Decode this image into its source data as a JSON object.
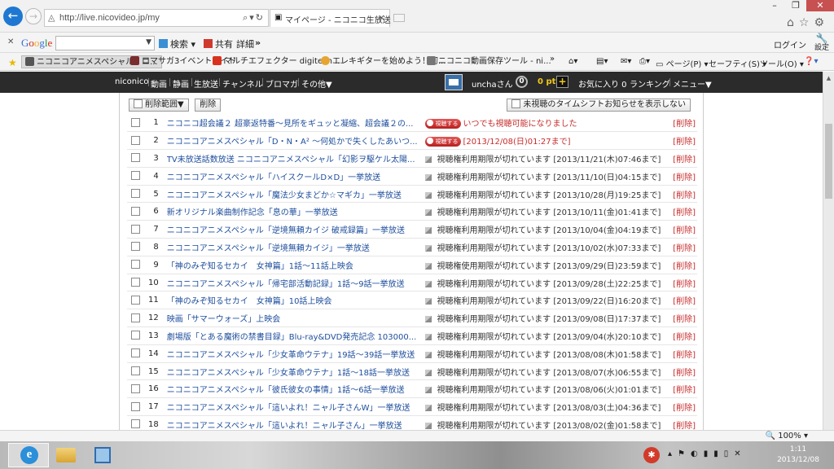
{
  "browser": {
    "url": "http://live.nicovideo.jp/my",
    "tab_title": "マイページ - ニコニコ生放送"
  },
  "google_toolbar": {
    "logo": "Google",
    "search_label": "検索",
    "share_label": "共有",
    "details_label": "詳細",
    "more": "»",
    "login": "ログイン",
    "settings": "設定"
  },
  "favorites": [
    "ニコニコアニメスペシャル - ニ...",
    "ロマサガ3イベントガイド",
    "マルチエフェクター digitech ...",
    "エレキギターを始めよう！初...",
    "ニコニコ動画保存ツール - ni..."
  ],
  "favorites_more": "»",
  "commands": {
    "page": "ページ(P)",
    "safety": "セーフティ(S)",
    "tools": "ツール(O)"
  },
  "nico_header": {
    "links": [
      "niconico",
      "動画",
      "静画",
      "生放送",
      "チャンネル",
      "ブロマガ",
      "その他▼"
    ],
    "username": "unchaさん",
    "points_badge": "0",
    "points": "0 pt",
    "plus": "+",
    "favorites": "お気に入り 0",
    "ranking": "ランキング",
    "menu": "メニュー▼"
  },
  "controls": {
    "delete_range": "削除範囲▼",
    "delete": "削除",
    "hide_unwatched": "未視聴のタイムシフトお知らせを表示しない",
    "watch_badge": "視聴する"
  },
  "rows": [
    {
      "num": "1",
      "title": "ニコニコ超会議２ 超豪返特番〜見所をギュッと凝縮、超会議２の...",
      "status": "いつでも視聴可能になりました",
      "kind": "watch",
      "delete": "[削除]"
    },
    {
      "num": "2",
      "title": "ニコニコアニメスペシャル「D・N・A² 〜何処かで失くしたあいつ...",
      "status": "[2013/12/08(日)01:27まで]",
      "kind": "watch",
      "delete": "[削除]"
    },
    {
      "num": "3",
      "title": "TV未放送話数放送 ニコニコアニメスペシャル「幻影ヲ駆ケル太陽...",
      "status": "視聴権利用期限が切れています [2013/11/21(木)07:46まで]",
      "kind": "expired",
      "delete": "[削除]"
    },
    {
      "num": "4",
      "title": "ニコニコアニメスペシャル「ハイスクールD×D」一挙放送",
      "status": "視聴権利用期限が切れています [2013/11/10(日)04:15まで]",
      "kind": "expired",
      "delete": "[削除]"
    },
    {
      "num": "5",
      "title": "ニコニコアニメスペシャル「魔法少女まどか☆マギカ」一挙放送",
      "status": "視聴権利用期限が切れています [2013/10/28(月)19:25まで]",
      "kind": "expired",
      "delete": "[削除]"
    },
    {
      "num": "6",
      "title": "新オリジナル楽曲制作記念「息の華」一挙放送",
      "status": "視聴権利用期限が切れています [2013/10/11(金)01:41まで]",
      "kind": "expired",
      "delete": "[削除]"
    },
    {
      "num": "7",
      "title": "ニコニコアニメスペシャル「逆境無頼カイジ 破戒録篇」一挙放送",
      "status": "視聴権利用期限が切れています [2013/10/04(金)04:19まで]",
      "kind": "expired",
      "delete": "[削除]"
    },
    {
      "num": "8",
      "title": "ニコニコアニメスペシャル「逆境無頼カイジ」一挙放送",
      "status": "視聴権利用期限が切れています [2013/10/02(水)07:33まで]",
      "kind": "expired",
      "delete": "[削除]"
    },
    {
      "num": "9",
      "title": "「神のみぞ知るセカイ　女神篇」1話〜11話上映会",
      "status": "視聴権使用期限が切れています [2013/09/29(日)23:59まで]",
      "kind": "expired",
      "delete": "[削除]"
    },
    {
      "num": "10",
      "title": "ニコニコアニメスペシャル「帰宅部活動記録」1話〜9話一挙放送",
      "status": "視聴権利用期限が切れています [2013/09/28(土)22:25まで]",
      "kind": "expired",
      "delete": "[削除]"
    },
    {
      "num": "11",
      "title": "「神のみぞ知るセカイ　女神篇」10話上映会",
      "status": "視聴権利用期限が切れています [2013/09/22(日)16:20まで]",
      "kind": "expired",
      "delete": "[削除]"
    },
    {
      "num": "12",
      "title": "映画「サマーウォーズ」上映会",
      "status": "視聴権利用期限が切れています [2013/09/08(日)17:37まで]",
      "kind": "expired",
      "delete": "[削除]"
    },
    {
      "num": "13",
      "title": "劇場版「とある魔術の禁書目録」Blu-ray&DVD発売記念 103000...",
      "status": "視聴権利用期限が切れています [2013/09/04(水)20:10まで]",
      "kind": "expired",
      "delete": "[削除]"
    },
    {
      "num": "14",
      "title": "ニコニコアニメスペシャル「少女革命ウテナ」19話〜39話一挙放送",
      "status": "視聴権利用期限が切れています [2013/08/08(木)01:58まで]",
      "kind": "expired",
      "delete": "[削除]"
    },
    {
      "num": "15",
      "title": "ニコニコアニメスペシャル「少女革命ウテナ」1話〜18話一挙放送",
      "status": "視聴権利用期限が切れています [2013/08/07(水)06:55まで]",
      "kind": "expired",
      "delete": "[削除]"
    },
    {
      "num": "16",
      "title": "ニコニコアニメスペシャル「彼氏彼女の事情」1話〜6話一挙放送",
      "status": "視聴権利用期限が切れています [2013/08/06(火)01:01まで]",
      "kind": "expired",
      "delete": "[削除]"
    },
    {
      "num": "17",
      "title": "ニコニコアニメスペシャル「這いよれ！ニャル子さんW」一挙放送",
      "status": "視聴権利用期限が切れています [2013/08/03(土)04:36まで]",
      "kind": "expired",
      "delete": "[削除]"
    },
    {
      "num": "18",
      "title": "ニコニコアニメスペシャル「這いよれ！ニャル子さん」一挙放送",
      "status": "視聴権利用期限が切れています [2013/08/02(金)01:58まで]",
      "kind": "expired",
      "delete": "[削除]"
    }
  ],
  "status_bar": {
    "zoom": "100%"
  },
  "taskbar": {
    "time": "1:11",
    "date": "2013/12/08"
  }
}
